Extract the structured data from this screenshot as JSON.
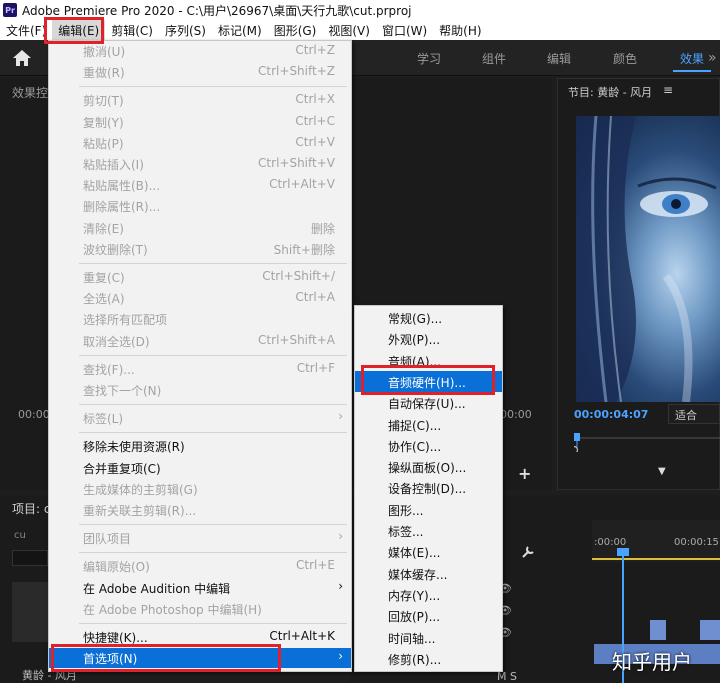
{
  "window": {
    "title": "Adobe Premiere Pro 2020 - C:\\用户\\26967\\桌面\\天行九歌\\cut.prproj",
    "logo": "Pr"
  },
  "menubar": [
    "文件(F)",
    "编辑(E)",
    "剪辑(C)",
    "序列(S)",
    "标记(M)",
    "图形(G)",
    "视图(V)",
    "窗口(W)",
    "帮助(H)"
  ],
  "workspaces": [
    "学习",
    "组件",
    "编辑",
    "颜色",
    "效果"
  ],
  "active_workspace": "效果",
  "panels": {
    "effects_title": "效果控",
    "program_title": "节目: 黄龄 - 风月",
    "program_timecode": "00:00:04:07",
    "fit_label": "适合",
    "left_timecode": "00:00",
    "mid_timecode": "00:00",
    "project_title": "项目: c",
    "project_file": "cu",
    "project_clip": "黄龄 - 风月",
    "timeline_time1": ":00:00",
    "timeline_time2": "00:00:15:00",
    "track_labels": "M  S",
    "watermark": "知乎用户"
  },
  "edit_menu": [
    {
      "label": "撤消(U)",
      "shortcut": "Ctrl+Z",
      "enabled": false
    },
    {
      "label": "重做(R)",
      "shortcut": "Ctrl+Shift+Z",
      "enabled": false
    },
    {
      "sep": true
    },
    {
      "label": "剪切(T)",
      "shortcut": "Ctrl+X",
      "enabled": false
    },
    {
      "label": "复制(Y)",
      "shortcut": "Ctrl+C",
      "enabled": false
    },
    {
      "label": "粘贴(P)",
      "shortcut": "Ctrl+V",
      "enabled": false
    },
    {
      "label": "粘贴插入(I)",
      "shortcut": "Ctrl+Shift+V",
      "enabled": false
    },
    {
      "label": "粘贴属性(B)...",
      "shortcut": "Ctrl+Alt+V",
      "enabled": false
    },
    {
      "label": "删除属性(R)...",
      "shortcut": "",
      "enabled": false
    },
    {
      "label": "清除(E)",
      "shortcut": "删除",
      "enabled": false
    },
    {
      "label": "波纹删除(T)",
      "shortcut": "Shift+删除",
      "enabled": false
    },
    {
      "sep": true
    },
    {
      "label": "重复(C)",
      "shortcut": "Ctrl+Shift+/",
      "enabled": false
    },
    {
      "label": "全选(A)",
      "shortcut": "Ctrl+A",
      "enabled": false
    },
    {
      "label": "选择所有匹配项",
      "shortcut": "",
      "enabled": false
    },
    {
      "label": "取消全选(D)",
      "shortcut": "Ctrl+Shift+A",
      "enabled": false
    },
    {
      "sep": true
    },
    {
      "label": "查找(F)...",
      "shortcut": "Ctrl+F",
      "enabled": false
    },
    {
      "label": "查找下一个(N)",
      "shortcut": "",
      "enabled": false
    },
    {
      "sep": true
    },
    {
      "label": "标签(L)",
      "shortcut": "",
      "enabled": false,
      "submenu": true
    },
    {
      "sep": true
    },
    {
      "label": "移除未使用资源(R)",
      "shortcut": "",
      "enabled": true
    },
    {
      "label": "合并重复项(C)",
      "shortcut": "",
      "enabled": true
    },
    {
      "label": "生成媒体的主剪辑(G)",
      "shortcut": "",
      "enabled": false
    },
    {
      "label": "重新关联主剪辑(R)...",
      "shortcut": "",
      "enabled": false
    },
    {
      "sep": true
    },
    {
      "label": "团队项目",
      "shortcut": "",
      "enabled": false,
      "submenu": true
    },
    {
      "sep": true
    },
    {
      "label": "编辑原始(O)",
      "shortcut": "Ctrl+E",
      "enabled": false
    },
    {
      "label": "在 Adobe Audition 中编辑",
      "shortcut": "",
      "enabled": true,
      "submenu": true
    },
    {
      "label": "在 Adobe Photoshop 中编辑(H)",
      "shortcut": "",
      "enabled": false
    },
    {
      "sep": true
    },
    {
      "label": "快捷键(K)...",
      "shortcut": "Ctrl+Alt+K",
      "enabled": true
    },
    {
      "label": "首选项(N)",
      "shortcut": "",
      "enabled": true,
      "submenu": true,
      "highlighted": true
    }
  ],
  "preferences_submenu": [
    {
      "label": "常规(G)..."
    },
    {
      "label": "外观(P)..."
    },
    {
      "label": "音频(A)..."
    },
    {
      "label": "音频硬件(H)...",
      "highlighted": true
    },
    {
      "label": "自动保存(U)..."
    },
    {
      "label": "捕捉(C)..."
    },
    {
      "label": "协作(C)..."
    },
    {
      "label": "操纵面板(O)..."
    },
    {
      "label": "设备控制(D)..."
    },
    {
      "label": "图形..."
    },
    {
      "label": "标签..."
    },
    {
      "label": "媒体(E)..."
    },
    {
      "label": "媒体缓存..."
    },
    {
      "label": "内存(Y)..."
    },
    {
      "label": "回放(P)..."
    },
    {
      "label": "时间轴..."
    },
    {
      "label": "修剪(R)..."
    }
  ],
  "colors": {
    "highlight": "#0a6fd6",
    "accent": "#4aa3ff",
    "annotation": "#e0202a",
    "menu_bg": "#f2f2f2"
  },
  "icons": [
    "home-icon",
    "hamburger-icon",
    "chevron-right-icon",
    "wrench-icon",
    "eye-icon",
    "plus-icon"
  ]
}
